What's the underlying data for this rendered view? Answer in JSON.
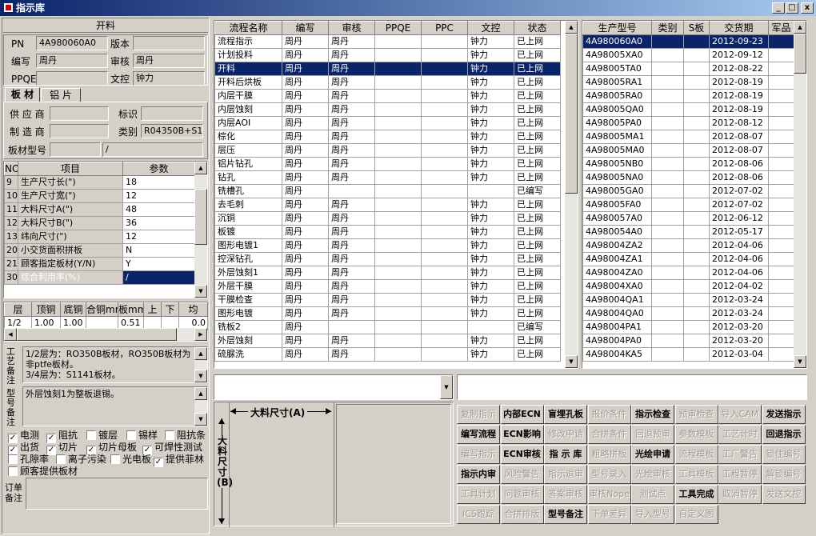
{
  "window": {
    "title": "指示库",
    "min": "_",
    "max": "□",
    "close": "x"
  },
  "left": {
    "header": "开料",
    "pn_label": "PN",
    "pn": "4A980060A0",
    "version_label": "版本",
    "version": "",
    "author_label": "编写",
    "author": "周丹",
    "review_label": "审核",
    "review": "周丹",
    "ppqe_label": "PPQE",
    "ppqe": "",
    "doc_label": "文控",
    "doc": "钟力",
    "tabs": [
      "板 材",
      "铝 片"
    ],
    "supplier_label": "供 应 商",
    "supplier": "",
    "mark_label": "标识",
    "mark": "",
    "maker_label": "制 造 商",
    "maker": "",
    "category_label": "类别",
    "category": "R04350B+S11",
    "model_label": "板材型号",
    "model": "",
    "model2": "/",
    "param_headers": [
      "NO",
      "项目",
      "参数"
    ],
    "params": [
      {
        "no": "9",
        "item": "生产尺寸长(\")",
        "val": "18"
      },
      {
        "no": "10",
        "item": "生产尺寸宽(\")",
        "val": "12"
      },
      {
        "no": "11",
        "item": "大料尺寸A(\")",
        "val": "48"
      },
      {
        "no": "12",
        "item": "大料尺寸B(\")",
        "val": "36"
      },
      {
        "no": "13",
        "item": "纬向尺寸(\")",
        "val": "12"
      },
      {
        "no": "20",
        "item": "小交货面积拼板",
        "val": "N"
      },
      {
        "no": "21",
        "item": "顾客指定板材(Y/N)",
        "val": "Y"
      },
      {
        "no": "30",
        "item": "综合利用率(%)",
        "val": "/"
      }
    ],
    "layer_headers": [
      "层",
      "顶铜",
      "底铜",
      "合铜mm",
      "板mm",
      "上",
      "下",
      "均"
    ],
    "layer_row": {
      "layer": "1/2",
      "top": "1.00",
      "bottom": "1.00",
      "total": "",
      "board": "0.51",
      "up": "",
      "down": "",
      "avg": "0.0"
    },
    "process_note_label": "工艺备注",
    "process_note": "1/2层为：RO350B板材，RO350B板材为非ptfe板材。\n3/4层为：S1141板材。",
    "model_note_label": "型号备注",
    "model_note": "外层蚀刻1为整板退锡。",
    "checks": [
      {
        "label": "电测",
        "checked": true
      },
      {
        "label": "阻抗",
        "checked": true
      },
      {
        "label": "镀层",
        "checked": false
      },
      {
        "label": "锡样",
        "checked": false
      },
      {
        "label": "阻抗条",
        "checked": false
      },
      {
        "label": "出货",
        "checked": true
      },
      {
        "label": "切片",
        "checked": true
      },
      {
        "label": "切片母板",
        "checked": true
      },
      {
        "label": "可焊性测试",
        "checked": true
      },
      {
        "label": "孔隙率",
        "checked": false
      },
      {
        "label": "离子污染",
        "checked": false
      },
      {
        "label": "光电板",
        "checked": false
      },
      {
        "label": "提供菲林",
        "checked": true
      },
      {
        "label": "顾客提供板材",
        "checked": false
      }
    ],
    "order_note_label": "订单备注",
    "order_note": ""
  },
  "flow": {
    "headers": [
      "流程名称",
      "编写",
      "审核",
      "PPQE",
      "PPC",
      "文控",
      "状态"
    ],
    "rows": [
      [
        "流程指示",
        "周丹",
        "周丹",
        "",
        "",
        "钟力",
        "已上网"
      ],
      [
        "计划投料",
        "周丹",
        "周丹",
        "",
        "",
        "钟力",
        "已上网"
      ],
      [
        "开料",
        "周丹",
        "周丹",
        "",
        "",
        "钟力",
        "已上网"
      ],
      [
        "开料后烘板",
        "周丹",
        "周丹",
        "",
        "",
        "钟力",
        "已上网"
      ],
      [
        "内层干膜",
        "周丹",
        "周丹",
        "",
        "",
        "钟力",
        "已上网"
      ],
      [
        "内层蚀刻",
        "周丹",
        "周丹",
        "",
        "",
        "钟力",
        "已上网"
      ],
      [
        "内层AOI",
        "周丹",
        "周丹",
        "",
        "",
        "钟力",
        "已上网"
      ],
      [
        "棕化",
        "周丹",
        "周丹",
        "",
        "",
        "钟力",
        "已上网"
      ],
      [
        "层压",
        "周丹",
        "周丹",
        "",
        "",
        "钟力",
        "已上网"
      ],
      [
        "铝片钻孔",
        "周丹",
        "周丹",
        "",
        "",
        "钟力",
        "已上网"
      ],
      [
        "钻孔",
        "周丹",
        "周丹",
        "",
        "",
        "钟力",
        "已上网"
      ],
      [
        "铣槽孔",
        "周丹",
        "",
        "",
        "",
        "",
        "已编写"
      ],
      [
        "去毛刺",
        "周丹",
        "周丹",
        "",
        "",
        "钟力",
        "已上网"
      ],
      [
        "沉铜",
        "周丹",
        "周丹",
        "",
        "",
        "钟力",
        "已上网"
      ],
      [
        "板镀",
        "周丹",
        "周丹",
        "",
        "",
        "钟力",
        "已上网"
      ],
      [
        "图形电镀1",
        "周丹",
        "周丹",
        "",
        "",
        "钟力",
        "已上网"
      ],
      [
        "控深钻孔",
        "周丹",
        "周丹",
        "",
        "",
        "钟力",
        "已上网"
      ],
      [
        "外层蚀刻1",
        "周丹",
        "周丹",
        "",
        "",
        "钟力",
        "已上网"
      ],
      [
        "外层干膜",
        "周丹",
        "周丹",
        "",
        "",
        "钟力",
        "已上网"
      ],
      [
        "干膜检查",
        "周丹",
        "周丹",
        "",
        "",
        "钟力",
        "已上网"
      ],
      [
        "图形电镀",
        "周丹",
        "周丹",
        "",
        "",
        "钟力",
        "已上网"
      ],
      [
        "铣板2",
        "周丹",
        "",
        "",
        "",
        "",
        "已编写"
      ],
      [
        "外层蚀刻",
        "周丹",
        "周丹",
        "",
        "",
        "钟力",
        "已上网"
      ],
      [
        "硫脲洗",
        "周丹",
        "周丹",
        "",
        "",
        "钟力",
        "已上网"
      ]
    ],
    "selected": 2
  },
  "models": {
    "headers": [
      "生产型号",
      "类别",
      "S板",
      "交货期",
      "军品"
    ],
    "rows": [
      [
        "4A980060A0",
        "",
        "",
        "2012-09-23",
        ""
      ],
      [
        "4A98005XA0",
        "",
        "",
        "2012-09-12",
        ""
      ],
      [
        "4A98005TA0",
        "",
        "",
        "2012-08-22",
        ""
      ],
      [
        "4A98005RA1",
        "",
        "",
        "2012-08-19",
        ""
      ],
      [
        "4A98005RA0",
        "",
        "",
        "2012-08-19",
        ""
      ],
      [
        "4A98005QA0",
        "",
        "",
        "2012-08-19",
        ""
      ],
      [
        "4A98005PA0",
        "",
        "",
        "2012-08-12",
        ""
      ],
      [
        "4A98005MA1",
        "",
        "",
        "2012-08-07",
        ""
      ],
      [
        "4A98005MA0",
        "",
        "",
        "2012-08-07",
        ""
      ],
      [
        "4A98005NB0",
        "",
        "",
        "2012-08-06",
        ""
      ],
      [
        "4A98005NA0",
        "",
        "",
        "2012-08-06",
        ""
      ],
      [
        "4A98005GA0",
        "",
        "",
        "2012-07-02",
        ""
      ],
      [
        "4A98005FA0",
        "",
        "",
        "2012-07-02",
        ""
      ],
      [
        "4A980057A0",
        "",
        "",
        "2012-06-12",
        ""
      ],
      [
        "4A980054A0",
        "",
        "",
        "2012-05-17",
        ""
      ],
      [
        "4A98004ZA2",
        "",
        "",
        "2012-04-06",
        ""
      ],
      [
        "4A98004ZA1",
        "",
        "",
        "2012-04-06",
        ""
      ],
      [
        "4A98004ZA0",
        "",
        "",
        "2012-04-06",
        ""
      ],
      [
        "4A98004XA0",
        "",
        "",
        "2012-04-02",
        ""
      ],
      [
        "4A98004QA1",
        "",
        "",
        "2012-03-24",
        ""
      ],
      [
        "4A98004QA0",
        "",
        "",
        "2012-03-24",
        ""
      ],
      [
        "4A98004PA1",
        "",
        "",
        "2012-03-20",
        ""
      ],
      [
        "4A98004PA0",
        "",
        "",
        "2012-03-20",
        ""
      ],
      [
        "4A98004KA5",
        "",
        "",
        "2012-03-04",
        ""
      ]
    ]
  },
  "diagram": {
    "a_label": "大料尺寸(A)",
    "b_label": "大料尺寸(B)"
  },
  "buttons": [
    [
      {
        "t": "复制指示",
        "e": false
      },
      {
        "t": "内部ECN",
        "e": true
      },
      {
        "t": "盲埋孔板",
        "e": true
      },
      {
        "t": "报价条件",
        "e": false
      },
      {
        "t": "指示检查",
        "e": true
      },
      {
        "t": "预审检查",
        "e": false
      },
      {
        "t": "导入CAM",
        "e": false
      },
      {
        "t": "发送指示",
        "e": true
      }
    ],
    [
      {
        "t": "编写流程",
        "e": true
      },
      {
        "t": "ECN影响",
        "e": true
      },
      {
        "t": "修改申请",
        "e": false
      },
      {
        "t": "合拼条件",
        "e": false
      },
      {
        "t": "回退预审",
        "e": false
      },
      {
        "t": "参数模板",
        "e": false
      },
      {
        "t": "工艺计时",
        "e": false
      },
      {
        "t": "回退指示",
        "e": true
      }
    ],
    [
      {
        "t": "编写指示",
        "e": false
      },
      {
        "t": "ECN审核",
        "e": true
      },
      {
        "t": "指 示 库",
        "e": true
      },
      {
        "t": "粗略拼板",
        "e": false
      },
      {
        "t": "光绘申请",
        "e": true
      },
      {
        "t": "流程模板",
        "e": false
      },
      {
        "t": "工厂警告",
        "e": false
      },
      {
        "t": "锁住编号",
        "e": false
      }
    ],
    [
      {
        "t": "指示内审",
        "e": true
      },
      {
        "t": "风险警告",
        "e": false
      },
      {
        "t": "指示退审",
        "e": false
      },
      {
        "t": "型号录入",
        "e": false
      },
      {
        "t": "光绘审核",
        "e": false
      },
      {
        "t": "工具模板",
        "e": false
      },
      {
        "t": "工程暂停",
        "e": false
      },
      {
        "t": "解锁编号",
        "e": false
      }
    ],
    [
      {
        "t": "工具计划",
        "e": false
      },
      {
        "t": "问题审核",
        "e": false
      },
      {
        "t": "答案审核",
        "e": false
      },
      {
        "t": "审核Nope",
        "e": false
      },
      {
        "t": "测试点",
        "e": false
      },
      {
        "t": "工具完成",
        "e": true
      },
      {
        "t": "取消暂停",
        "e": false
      },
      {
        "t": "发送文控",
        "e": false
      }
    ],
    [
      {
        "t": "ICS跟踪",
        "e": false
      },
      {
        "t": "合拼排版",
        "e": false
      },
      {
        "t": "型号备注",
        "e": true
      },
      {
        "t": "下单差异",
        "e": false
      },
      {
        "t": "导入型号",
        "e": false
      },
      {
        "t": "自定义图",
        "e": false
      }
    ]
  ]
}
